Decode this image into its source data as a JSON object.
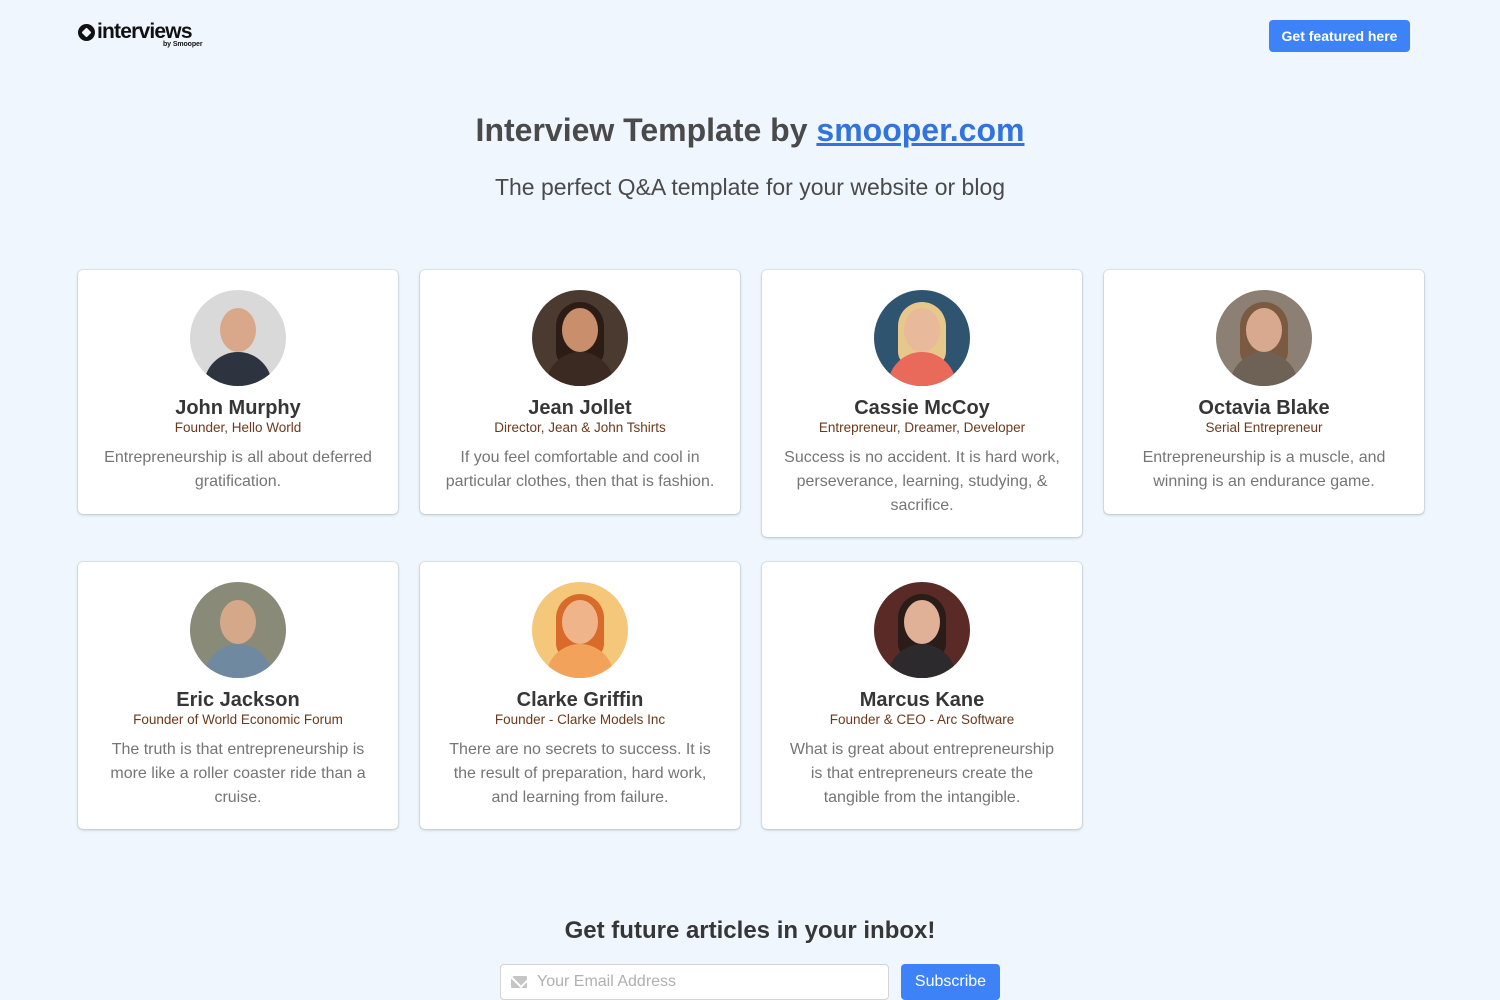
{
  "header": {
    "logo_text": "interviews",
    "logo_subtext": "by Smooper",
    "featured_button": "Get featured here"
  },
  "hero": {
    "title_prefix": "Interview Template by ",
    "title_link": "smooper.com",
    "subtitle": "The perfect Q&A template for your website or blog"
  },
  "cards": [
    {
      "name": "John Murphy",
      "role": "Founder, Hello World",
      "quote": "Entrepreneurship is all about deferred gratification.",
      "avatar_colors": {
        "bg": "#d9d9d9",
        "skin": "#d9a88a",
        "hair": "#d9d9d9",
        "clothes": "#2d3440"
      }
    },
    {
      "name": "Jean Jollet",
      "role": "Director, Jean & John Tshirts",
      "quote": "If you feel comfortable and cool in particular clothes, then that is fashion.",
      "avatar_colors": {
        "bg": "#4a3a30",
        "skin": "#c98f6d",
        "hair": "#2b1d15",
        "clothes": "#3a2a22"
      }
    },
    {
      "name": "Cassie McCoy",
      "role": "Entrepreneur, Dreamer, Developer",
      "quote": "Success is no accident. It is hard work, perseverance, learning, studying, & sacrifice.",
      "avatar_colors": {
        "bg": "#2f5470",
        "skin": "#e8b99a",
        "hair": "#e6c88a",
        "clothes": "#e96a5a"
      }
    },
    {
      "name": "Octavia Blake",
      "role": "Serial Entrepreneur",
      "quote": "Entrepreneurship is a muscle, and winning is an endurance game.",
      "avatar_colors": {
        "bg": "#8c8074",
        "skin": "#d8a98e",
        "hair": "#7a5a40",
        "clothes": "#6e6257"
      }
    },
    {
      "name": "Eric Jackson",
      "role": "Founder of World Economic Forum",
      "quote": "The truth is that entrepreneurship is more like a roller coaster ride than a cruise.",
      "avatar_colors": {
        "bg": "#8a8a78",
        "skin": "#d6a88a",
        "hair": "#8a8a78",
        "clothes": "#6f8aa0"
      }
    },
    {
      "name": "Clarke Griffin",
      "role": "Founder - Clarke Models Inc",
      "quote": "There are no secrets to success. It is the result of preparation, hard work, and learning from failure.",
      "avatar_colors": {
        "bg": "#f5c77a",
        "skin": "#f0b48a",
        "hair": "#d86a2a",
        "clothes": "#f2a25a"
      }
    },
    {
      "name": "Marcus Kane",
      "role": "Founder & CEO - Arc Software",
      "quote": "What is great about entrepreneurship is that entrepreneurs create the tangible from the intangible.",
      "avatar_colors": {
        "bg": "#5a2a26",
        "skin": "#e0b097",
        "hair": "#2a1c18",
        "clothes": "#2c2a2c"
      }
    }
  ],
  "newsletter": {
    "title": "Get future articles in your inbox!",
    "email_placeholder": "Your Email Address",
    "subscribe_button": "Subscribe"
  },
  "colors": {
    "background": "#eff6fe",
    "accent": "#3e82f7",
    "link": "#3273dc",
    "role_text": "#6b3a1c"
  }
}
